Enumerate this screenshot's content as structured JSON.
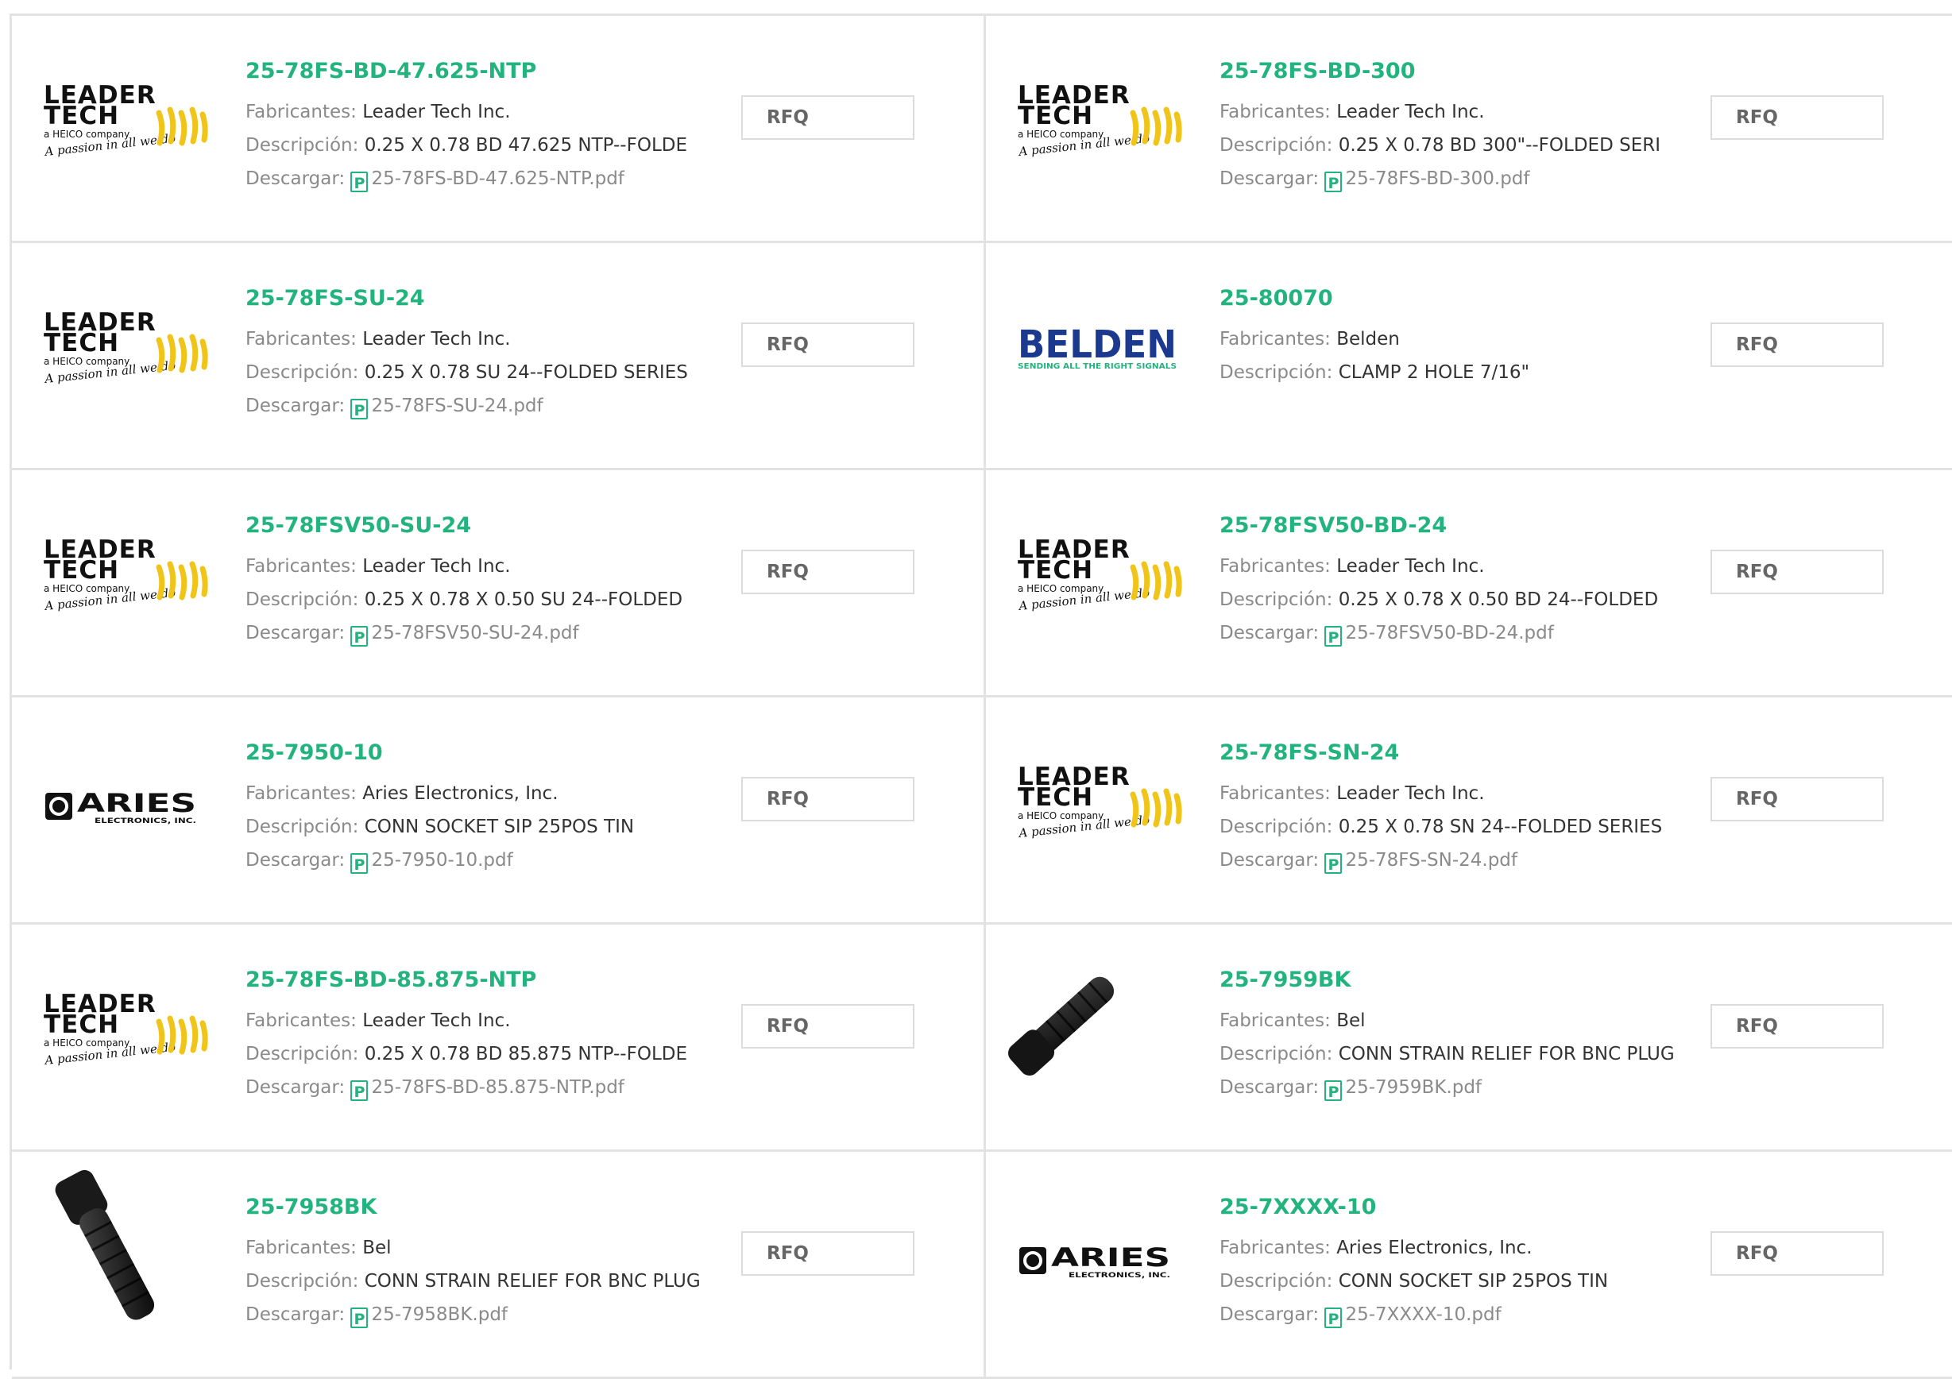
{
  "labels": {
    "manufacturer": "Fabricantes: ",
    "description": "Descripción: ",
    "download": "Descargar: ",
    "rfq": "RFQ",
    "pdf_icon_glyph": "P"
  },
  "logos": {
    "leadertech": {
      "line1": "LEADER",
      "line2": "TECH",
      "line3": "a HEICO company",
      "line4": "A passion in all we do"
    },
    "belden": {
      "main": "BELDEN",
      "tagline": "SENDING ALL THE RIGHT SIGNALS"
    },
    "aries": {
      "main": "ARIES",
      "sub": "ELECTRONICS, INC."
    }
  },
  "colors": {
    "accent": "#23b37f",
    "border": "#e2e2e2",
    "label": "#8a8a8a",
    "text": "#333333"
  },
  "products": [
    {
      "part": "25-78FS-BD-47.625-NTP",
      "manufacturer": "Leader Tech Inc.",
      "description": "0.25 X 0.78 BD 47.625 NTP--FOLDE",
      "pdf": "25-78FS-BD-47.625-NTP.pdf",
      "logo": "leadertech"
    },
    {
      "part": "25-78FS-BD-300",
      "manufacturer": "Leader Tech Inc.",
      "description": "0.25 X 0.78 BD 300\"--FOLDED SERI",
      "pdf": "25-78FS-BD-300.pdf",
      "logo": "leadertech"
    },
    {
      "part": "25-78FS-SU-24",
      "manufacturer": "Leader Tech Inc.",
      "description": "0.25 X 0.78 SU 24--FOLDED SERIES",
      "pdf": "25-78FS-SU-24.pdf",
      "logo": "leadertech"
    },
    {
      "part": "25-80070",
      "manufacturer": "Belden",
      "description": "CLAMP 2 HOLE 7/16\"",
      "pdf": "",
      "logo": "belden"
    },
    {
      "part": "25-78FSV50-SU-24",
      "manufacturer": "Leader Tech Inc.",
      "description": "0.25 X 0.78 X 0.50 SU 24--FOLDED",
      "pdf": "25-78FSV50-SU-24.pdf",
      "logo": "leadertech"
    },
    {
      "part": "25-78FSV50-BD-24",
      "manufacturer": "Leader Tech Inc.",
      "description": "0.25 X 0.78 X 0.50 BD 24--FOLDED",
      "pdf": "25-78FSV50-BD-24.pdf",
      "logo": "leadertech"
    },
    {
      "part": "25-7950-10",
      "manufacturer": "Aries Electronics, Inc.",
      "description": "CONN SOCKET SIP 25POS TIN",
      "pdf": "25-7950-10.pdf",
      "logo": "aries"
    },
    {
      "part": "25-78FS-SN-24",
      "manufacturer": "Leader Tech Inc.",
      "description": "0.25 X 0.78 SN 24--FOLDED SERIES",
      "pdf": "25-78FS-SN-24.pdf",
      "logo": "leadertech"
    },
    {
      "part": "25-78FS-BD-85.875-NTP",
      "manufacturer": "Leader Tech Inc.",
      "description": "0.25 X 0.78 BD 85.875 NTP--FOLDE",
      "pdf": "25-78FS-BD-85.875-NTP.pdf",
      "logo": "leadertech"
    },
    {
      "part": "25-7959BK",
      "manufacturer": "Bel",
      "description": "CONN STRAIN RELIEF FOR BNC PLUG",
      "pdf": "25-7959BK.pdf",
      "logo": "bel-strain-relief-photo"
    },
    {
      "part": "25-7958BK",
      "manufacturer": "Bel",
      "description": "CONN STRAIN RELIEF FOR BNC PLUG",
      "pdf": "25-7958BK.pdf",
      "logo": "bel-strain-relief-photo"
    },
    {
      "part": "25-7XXXX-10",
      "manufacturer": "Aries Electronics, Inc.",
      "description": "CONN SOCKET SIP 25POS TIN",
      "pdf": "25-7XXXX-10.pdf",
      "logo": "aries"
    }
  ]
}
